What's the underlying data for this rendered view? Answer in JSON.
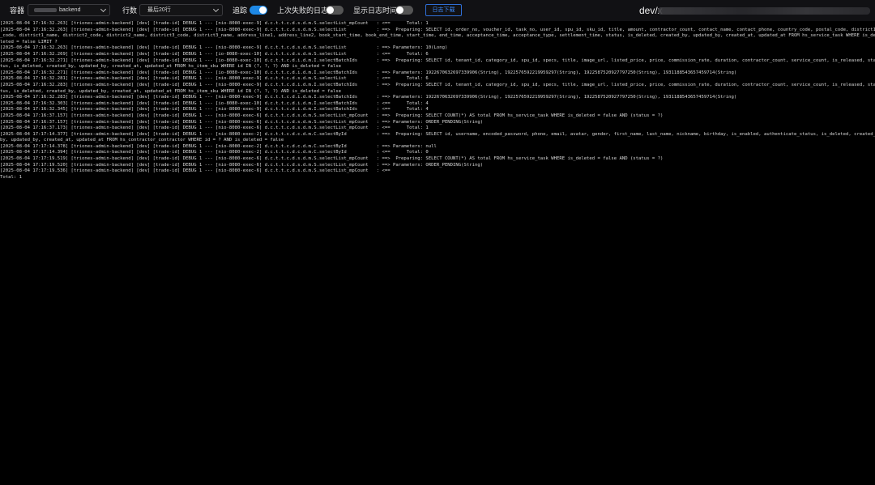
{
  "toolbar": {
    "container_label": "容器",
    "container_value": "backend",
    "rows_label": "行数",
    "rows_value": "最后20行",
    "follow_label": "追踪",
    "follow_on": true,
    "last_failed_label": "上次失败的日志",
    "last_failed_on": false,
    "show_time_label": "显示日志时间",
    "show_time_on": false,
    "download_label": "日志下载",
    "path_prefix": "dev/x"
  },
  "log_lines": [
    "[2025-08-04 17:16:32.263] [triones-admin-backend] [dev] [trade-id] DEBUG 1 --- [nio-8080-exec-9] d.c.t.t.c.d.s.d.m.S.selectList_mpCount   : <==      Total: 1",
    "[2025-08-04 17:16:32.263] [triones-admin-backend] [dev] [trade-id] DEBUG 1 --- [nio-8080-exec-9] d.c.t.t.c.d.s.d.m.S.selectList           : ==>  Preparing: SELECT id, order_no, voucher_id, task_no, user_id, spu_id, sku_id, title, amount, contractor_count, contact_name, contact_phone, country_code, postal_code, district1",
    "_code, district1_name, district2_code, district2_name, district3_code, district3_name, address_line1, address_line2, book_start_time, book_end_time, start_time, end_time, acceptance_time, acceptance_type, settlement_time, status, is_deleted, created_by, updated_by, created_at, updated_at FROM hs_service_task WHERE is_de",
    "leted = false LIMIT ?",
    "[2025-08-04 17:16:32.263] [triones-admin-backend] [dev] [trade-id] DEBUG 1 --- [nio-8080-exec-9] d.c.t.t.c.d.s.d.m.S.selectList           : ==> Parameters: 10(Long)",
    "[2025-08-04 17:16:32.269] [triones-admin-backend] [dev] [trade-id] DEBUG 1 --- [io-8080-exec-10] d.c.t.t.c.d.s.d.m.S.selectList           : <==      Total: 6",
    "[2025-08-04 17:16:32.271] [triones-admin-backend] [dev] [trade-id] DEBUG 1 --- [io-8080-exec-10] d.c.t.t.c.d.i.d.m.I.selectBatchIds       : ==>  Preparing: SELECT id, tenant_id, category_id, spu_id, specs, title, image_url, listed_price, price, commission_rate, duration, contractor_count, service_count, is_released, sta",
    "tus, is_deleted, created_by, updated_by, created_at, updated_at FROM hs_item_sku WHERE id IN (?, ?, ?) AND is_deleted = false",
    "[2025-08-04 17:16:32.271] [triones-admin-backend] [dev] [trade-id] DEBUG 1 --- [io-8080-exec-10] d.c.t.t.c.d.i.d.m.I.selectBatchIds       : ==> Parameters: 1922670632697339906(String), 1922576592219959297(String), 1922587520927797250(String), 1931188543657459714(String)",
    "[2025-08-04 17:16:32.281] [triones-admin-backend] [dev] [trade-id] DEBUG 1 --- [nio-8080-exec-9] d.c.t.t.c.d.s.d.m.S.selectList           : <==      Total: 6",
    "[2025-08-04 17:16:32.283] [triones-admin-backend] [dev] [trade-id] DEBUG 1 --- [nio-8080-exec-9] d.c.t.t.c.d.i.d.m.I.selectBatchIds       : ==>  Preparing: SELECT id, tenant_id, category_id, spu_id, specs, title, image_url, listed_price, price, commission_rate, duration, contractor_count, service_count, is_released, sta",
    "tus, is_deleted, created_by, updated_by, created_at, updated_at FROM hs_item_sku WHERE id IN (?, ?, ?) AND is_deleted = false",
    "[2025-08-04 17:16:32.283] [triones-admin-backend] [dev] [trade-id] DEBUG 1 --- [nio-8080-exec-9] d.c.t.t.c.d.i.d.m.I.selectBatchIds       : ==> Parameters: 1922670632697339906(String), 1922576592219959297(String), 1922587520927797250(String), 1931188543657459714(String)",
    "[2025-08-04 17:16:32.303] [triones-admin-backend] [dev] [trade-id] DEBUG 1 --- [io-8080-exec-10] d.c.t.t.c.d.i.d.m.I.selectBatchIds       : <==      Total: 4",
    "[2025-08-04 17:16:32.345] [triones-admin-backend] [dev] [trade-id] DEBUG 1 --- [nio-8080-exec-9] d.c.t.t.c.d.i.d.m.I.selectBatchIds       : <==      Total: 4",
    "[2025-08-04 17:16:37.157] [triones-admin-backend] [dev] [trade-id] DEBUG 1 --- [nio-8080-exec-6] d.c.t.t.c.d.s.d.m.S.selectList_mpCount   : ==>  Preparing: SELECT COUNT(*) AS total FROM hs_service_task WHERE is_deleted = false AND (status = ?)",
    "[2025-08-04 17:16:37.157] [triones-admin-backend] [dev] [trade-id] DEBUG 1 --- [nio-8080-exec-6] d.c.t.t.c.d.s.d.m.S.selectList_mpCount   : ==> Parameters: ORDER_PENDING(String)",
    "[2025-08-04 17:16:37.173] [triones-admin-backend] [dev] [trade-id] DEBUG 1 --- [nio-8080-exec-6] d.c.t.t.c.d.s.d.m.S.selectList_mpCount   : <==      Total: 1",
    "[2025-08-04 17:17:14.377] [triones-admin-backend] [dev] [trade-id] DEBUG 1 --- [nio-8080-exec-2] d.c.t.t.c.d.c.d.m.C.selectById           : ==>  Preparing: SELECT id, username, encoded_password, phone, email, avatar, gender, first_name, last_name, nickname, birthday, is_enabled, authenticate_status, is_deleted, created_",
    "by, updated_by, created_at, updated_at FROM hs_contractor_contractor WHERE id = ? AND is_deleted = false",
    "[2025-08-04 17:17:14.378] [triones-admin-backend] [dev] [trade-id] DEBUG 1 --- [nio-8080-exec-2] d.c.t.t.c.d.c.d.m.C.selectById           : ==> Parameters: null",
    "[2025-08-04 17:17:14.394] [triones-admin-backend] [dev] [trade-id] DEBUG 1 --- [nio-8080-exec-2] d.c.t.t.c.d.c.d.m.C.selectById           : <==      Total: 0",
    "[2025-08-04 17:17:19.519] [triones-admin-backend] [dev] [trade-id] DEBUG 1 --- [nio-8080-exec-6] d.c.t.t.c.d.s.d.m.S.selectList_mpCount   : ==>  Preparing: SELECT COUNT(*) AS total FROM hs_service_task WHERE is_deleted = false AND (status = ?)",
    "[2025-08-04 17:17:19.520] [triones-admin-backend] [dev] [trade-id] DEBUG 1 --- [nio-8080-exec-6] d.c.t.t.c.d.s.d.m.S.selectList_mpCount   : ==> Parameters: ORDER_PENDING(String)",
    "[2025-08-04 17:17:19.536] [triones-admin-backend] [dev] [trade-id] DEBUG 1 --- [nio-8080-exec-6] d.c.t.t.c.d.s.d.m.S.selectList_mpCount   : <==",
    "Total: 1"
  ]
}
